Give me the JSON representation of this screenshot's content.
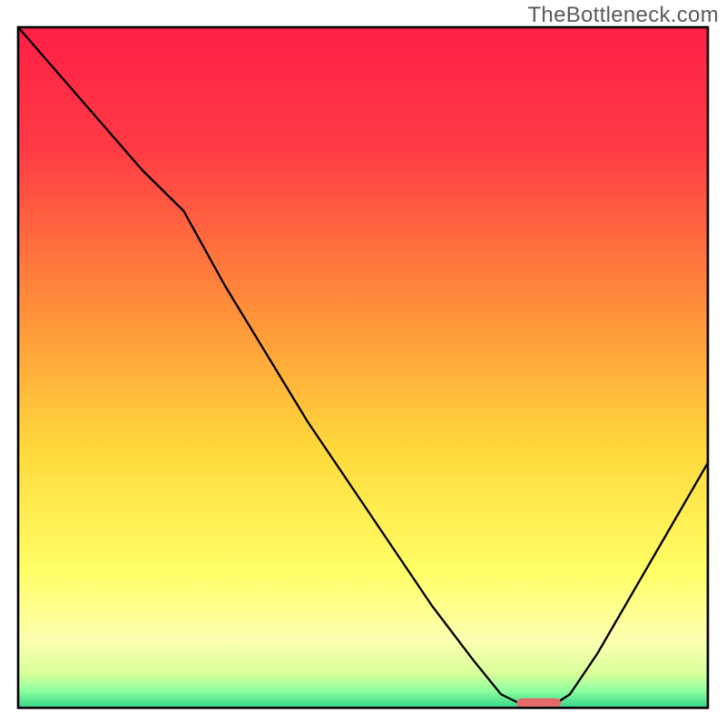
{
  "meta": {
    "watermark": "TheBottleneck.com"
  },
  "chart_data": {
    "type": "line",
    "title": "",
    "xlabel": "",
    "ylabel": "",
    "xlim": [
      0,
      100
    ],
    "ylim": [
      0,
      100
    ],
    "legend": false,
    "grid": false,
    "background": {
      "type": "vertical-gradient",
      "stops": [
        {
          "offset": 0.0,
          "color": "#ff1f47"
        },
        {
          "offset": 0.18,
          "color": "#ff3b45"
        },
        {
          "offset": 0.4,
          "color": "#ff8a3a"
        },
        {
          "offset": 0.62,
          "color": "#ffd93b"
        },
        {
          "offset": 0.8,
          "color": "#ffff66"
        },
        {
          "offset": 0.9,
          "color": "#fdffb0"
        },
        {
          "offset": 0.95,
          "color": "#d8ff9a"
        },
        {
          "offset": 0.975,
          "color": "#8fff9f"
        },
        {
          "offset": 1.0,
          "color": "#2fd48a"
        }
      ]
    },
    "series": [
      {
        "name": "bottleneck-curve",
        "color": "#000000",
        "stroke_width": 2.3,
        "x": [
          0.0,
          6.0,
          12.0,
          18.0,
          24.0,
          30.0,
          36.0,
          42.0,
          48.0,
          54.0,
          60.0,
          66.0,
          70.0,
          74.0,
          77.0,
          80.0,
          84.0,
          88.0,
          92.0,
          96.0,
          100.0
        ],
        "values": [
          100.0,
          93.0,
          86.0,
          79.0,
          73.0,
          62.0,
          52.0,
          42.0,
          33.0,
          24.0,
          15.0,
          7.0,
          2.0,
          0.0,
          0.0,
          2.0,
          8.0,
          15.0,
          22.0,
          29.0,
          36.0
        ]
      }
    ],
    "marker": {
      "name": "optimal-marker",
      "color": "#e46a6a",
      "x_center": 75.5,
      "x_half_width": 3.2,
      "y": 0.0,
      "height": 1.4
    }
  }
}
